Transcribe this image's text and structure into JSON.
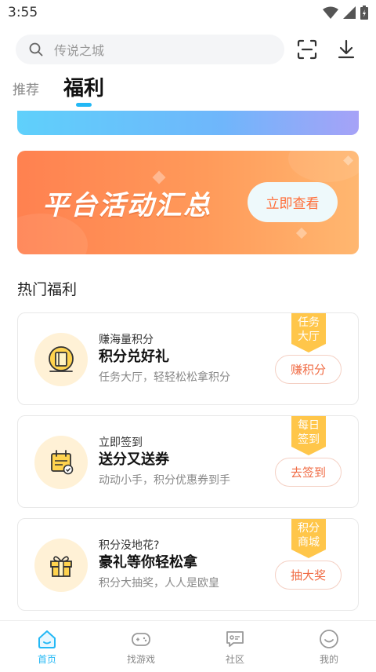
{
  "status_bar": {
    "time": "3:55"
  },
  "search": {
    "placeholder": "传说之城"
  },
  "tabs": [
    {
      "label": "推荐"
    },
    {
      "label": "福利"
    }
  ],
  "banner": {
    "title": "平台活动汇总",
    "button": "立即查看"
  },
  "section": {
    "title": "热门福利"
  },
  "cards": [
    {
      "sub": "赚海量积分",
      "main": "积分兑好礼",
      "desc": "任务大厅，轻轻松松拿积分",
      "action": "赚积分",
      "ribbon_line1": "任务",
      "ribbon_line2": "大厅",
      "icon": "book-coin-icon"
    },
    {
      "sub": "立即签到",
      "main": "送分又送券",
      "desc": "动动小手，积分优惠券到手",
      "action": "去签到",
      "ribbon_line1": "每日",
      "ribbon_line2": "签到",
      "icon": "calendar-check-icon"
    },
    {
      "sub": "积分没地花?",
      "main": "豪礼等你轻松拿",
      "desc": "积分大抽奖，人人是欧皇",
      "action": "抽大奖",
      "ribbon_line1": "积分",
      "ribbon_line2": "商城",
      "icon": "gift-box-icon"
    }
  ],
  "bottom_nav": [
    {
      "label": "首页",
      "icon": "home-icon"
    },
    {
      "label": "找游戏",
      "icon": "gamepad-icon"
    },
    {
      "label": "社区",
      "icon": "chat-icon"
    },
    {
      "label": "我的",
      "icon": "smile-icon"
    }
  ],
  "colors": {
    "accent": "#23b8f5",
    "orange": "#ff8150",
    "ribbon": "#ffc64a",
    "action_text": "#f06c45"
  }
}
